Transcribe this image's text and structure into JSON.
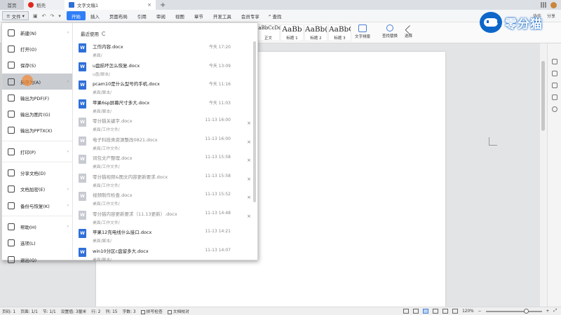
{
  "tabs": {
    "home": "首页",
    "docer": "稻壳",
    "active_doc": "文字文稿1",
    "close": "×",
    "new": "+"
  },
  "ribbon": {
    "file_label": "文件",
    "tabs": [
      "开始",
      "插入",
      "页面布局",
      "引用",
      "审阅",
      "视图",
      "章节",
      "开发工具",
      "会员专享"
    ],
    "active_tab": "开始",
    "search_label": "查找",
    "right_items": [
      "协作",
      "分享"
    ],
    "styles": [
      {
        "preview": "AaBbCcDd",
        "label": "正文",
        "small": true
      },
      {
        "preview": "AaBb",
        "label": "标题 1"
      },
      {
        "preview": "AaBb(",
        "label": "标题 2"
      },
      {
        "preview": "AaBbC",
        "label": "标题 3"
      }
    ],
    "text_layout": "文字排版",
    "find_replace": "查找替换",
    "select": "选择"
  },
  "file_menu": {
    "items": [
      {
        "label": "新建(N)",
        "icon": "new-file-icon",
        "submenu": true
      },
      {
        "label": "打开(O)",
        "icon": "folder-open-icon"
      },
      {
        "label": "保存(S)",
        "icon": "save-icon"
      },
      {
        "label": "另存为(A)",
        "icon": "save-as-icon",
        "submenu": true,
        "hover": true
      },
      {
        "label": "输出为PDF(F)",
        "icon": "pdf-icon"
      },
      {
        "label": "输出为图片(G)",
        "icon": "image-icon"
      },
      {
        "label": "输出为PPTX(X)",
        "icon": "pptx-icon"
      },
      {
        "label": "打印(P)",
        "icon": "printer-icon",
        "submenu": true
      },
      {
        "label": "分享文档(D)",
        "icon": "share-icon"
      },
      {
        "label": "文档加密(E)",
        "icon": "lock-icon",
        "submenu": true
      },
      {
        "label": "备份与恢复(K)",
        "icon": "backup-icon",
        "submenu": true
      },
      {
        "label": "帮助(H)",
        "icon": "help-icon",
        "submenu": true
      },
      {
        "label": "选项(L)",
        "icon": "options-icon"
      },
      {
        "label": "退出(Q)",
        "icon": "exit-icon"
      }
    ],
    "recent_title": "最近使用",
    "recent": [
      {
        "name": "工作内容.docx",
        "path": "桌面/",
        "time": "今天 17:20",
        "dim": false,
        "close": false
      },
      {
        "name": "u盘损坏怎么恢复.docx",
        "path": "u盘/脚本/",
        "time": "今天 13:09",
        "dim": false,
        "close": false
      },
      {
        "name": "pcam10是什么型号的手机.docx",
        "path": "桌面/脚本/",
        "time": "今天 11:16",
        "dim": false,
        "close": false
      },
      {
        "name": "苹果6sp屏幕尺寸多大.docx",
        "path": "桌面/脚本/",
        "time": "今天 11:03",
        "dim": false,
        "close": false
      },
      {
        "name": "零分猫关键字.docx",
        "path": "桌面/工作文件/",
        "time": "11-13 16:00",
        "dim": true,
        "close": true
      },
      {
        "name": "电子科技类资源整改0821.docx",
        "path": "桌面/工作文件/",
        "time": "11-13 16:00",
        "dim": true,
        "close": true
      },
      {
        "name": "词包文产整理.docx",
        "path": "桌面/工作文件/",
        "time": "11-13 15:58",
        "dim": true,
        "close": true
      },
      {
        "name": "零分猫视频&图文内容更新要求.docx",
        "path": "桌面/工作文件/",
        "time": "11-13 15:58",
        "dim": true,
        "close": true
      },
      {
        "name": "视频制作检查.docx",
        "path": "桌面/工作文件/",
        "time": "11-13 15:52",
        "dim": true,
        "close": true
      },
      {
        "name": "零分猫内容更新要求（11.13更新）.docx",
        "path": "桌面/工作文件/",
        "time": "11-13 14:48",
        "dim": true,
        "close": true
      },
      {
        "name": "苹果12充电线什么接口.docx",
        "path": "桌面/脚本/",
        "time": "11-13 14:21",
        "dim": false,
        "close": false
      },
      {
        "name": "win10分区c盘留多大.docx",
        "path": "桌面/脚本/",
        "time": "11-13 14:07",
        "dim": false,
        "close": false
      }
    ]
  },
  "statusbar": {
    "page_num": "页码: 1",
    "pages": "页面: 1/1",
    "section": "节: 1/1",
    "setting": "设置值: 3厘米",
    "row": "行: 2",
    "col": "列: 15",
    "words": "字数: 3",
    "spell": "拼写检查",
    "proof": "文档校对",
    "zoom": "120%"
  },
  "watermark": {
    "text": "零分猫"
  },
  "colors": {
    "accent": "#2f7ef7",
    "word_blue": "#2f6fd8",
    "wps_red": "#e0281f"
  }
}
